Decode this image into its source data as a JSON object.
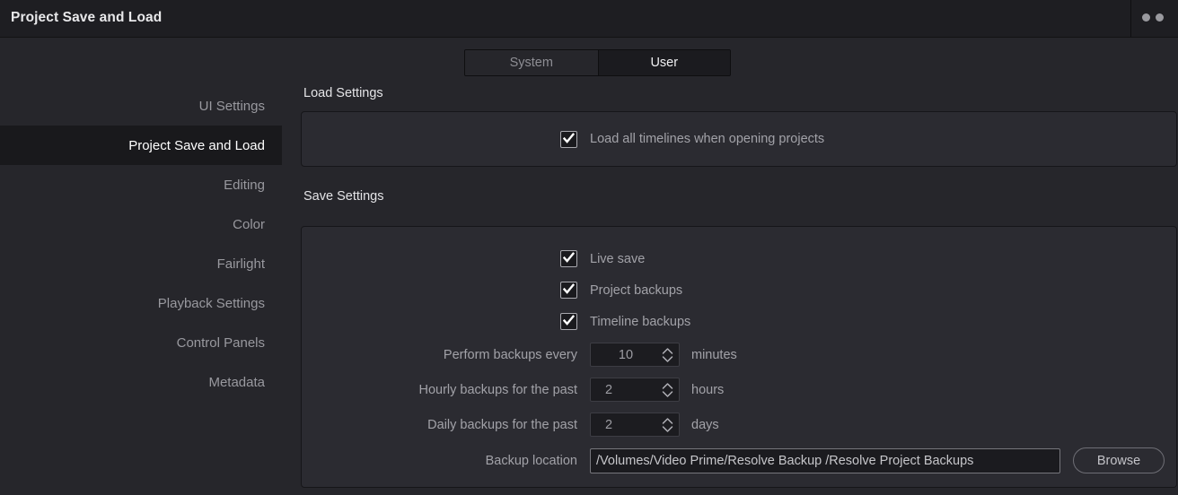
{
  "titlebar": {
    "title": "Project Save and Load",
    "window_dot_1": "window-dot",
    "window_dot_2": "window-dot"
  },
  "tabs": [
    {
      "label": "System",
      "active": false
    },
    {
      "label": "User",
      "active": true
    }
  ],
  "sidebar": {
    "items": [
      {
        "label": "UI Settings",
        "selected": false
      },
      {
        "label": "Project Save and Load",
        "selected": true
      },
      {
        "label": "Editing",
        "selected": false
      },
      {
        "label": "Color",
        "selected": false
      },
      {
        "label": "Fairlight",
        "selected": false
      },
      {
        "label": "Playback Settings",
        "selected": false
      },
      {
        "label": "Control Panels",
        "selected": false
      },
      {
        "label": "Metadata",
        "selected": false
      }
    ]
  },
  "load_settings": {
    "title": "Load Settings",
    "checkbox": {
      "label": "Load all timelines when opening projects",
      "checked": true
    }
  },
  "save_settings": {
    "title": "Save Settings",
    "checkboxes": [
      {
        "label": "Live save",
        "checked": true
      },
      {
        "label": "Project backups",
        "checked": true
      },
      {
        "label": "Timeline backups",
        "checked": true
      }
    ],
    "spinners": [
      {
        "label": "Perform backups every",
        "value": "10",
        "unit": "minutes"
      },
      {
        "label": "Hourly backups for the past",
        "value": "2",
        "unit": "hours"
      },
      {
        "label": "Daily backups for the past",
        "value": "2",
        "unit": "days"
      }
    ],
    "backup_location": {
      "label": "Backup location",
      "value": "/Volumes/Video Prime/Resolve Backup /Resolve Project Backups",
      "browse_label": "Browse"
    }
  },
  "colors": {
    "window_background": "#26262b",
    "titlebar_background": "#1e1e22",
    "panel_background": "#2b2b31",
    "selected_row": "#19191c",
    "text_primary": "#e8e8ea",
    "text_secondary": "#a2a2a8"
  }
}
